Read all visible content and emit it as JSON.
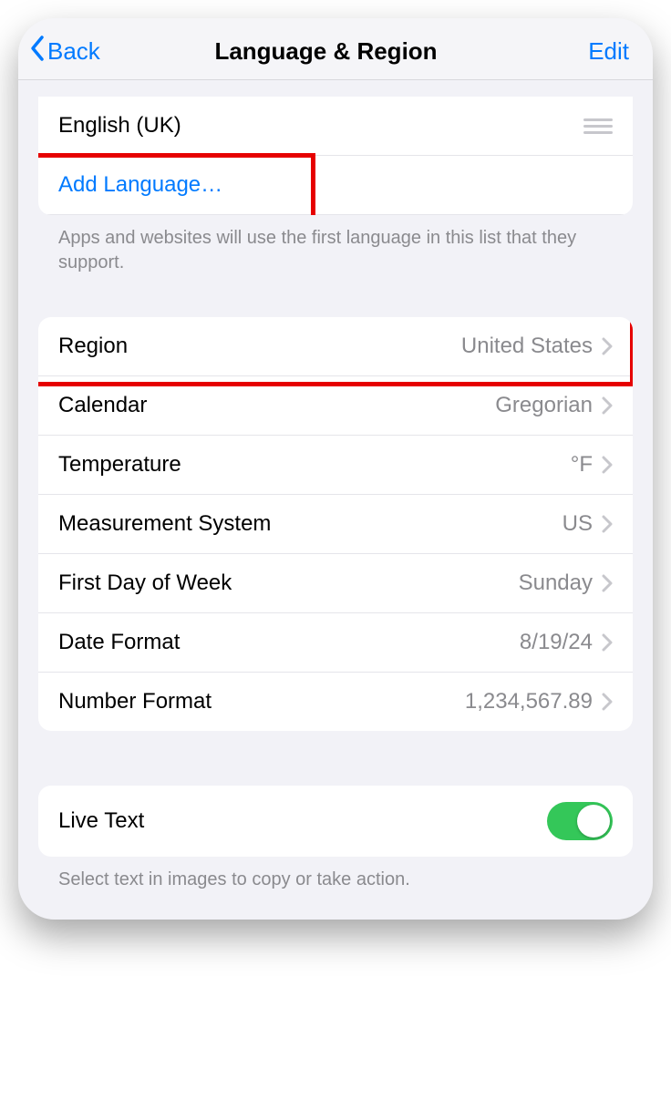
{
  "nav": {
    "back_label": "Back",
    "title": "Language & Region",
    "edit_label": "Edit"
  },
  "languages": {
    "items": [
      {
        "label": "English (UK)"
      }
    ],
    "add_label": "Add Language…",
    "footer": "Apps and websites will use the first language in this list that they support."
  },
  "region_settings": [
    {
      "label": "Region",
      "value": "United States"
    },
    {
      "label": "Calendar",
      "value": "Gregorian"
    },
    {
      "label": "Temperature",
      "value": "°F"
    },
    {
      "label": "Measurement System",
      "value": "US"
    },
    {
      "label": "First Day of Week",
      "value": "Sunday"
    },
    {
      "label": "Date Format",
      "value": "8/19/24"
    },
    {
      "label": "Number Format",
      "value": "1,234,567.89"
    }
  ],
  "live_text": {
    "label": "Live Text",
    "on": true,
    "footer": "Select text in images to copy or take action."
  }
}
